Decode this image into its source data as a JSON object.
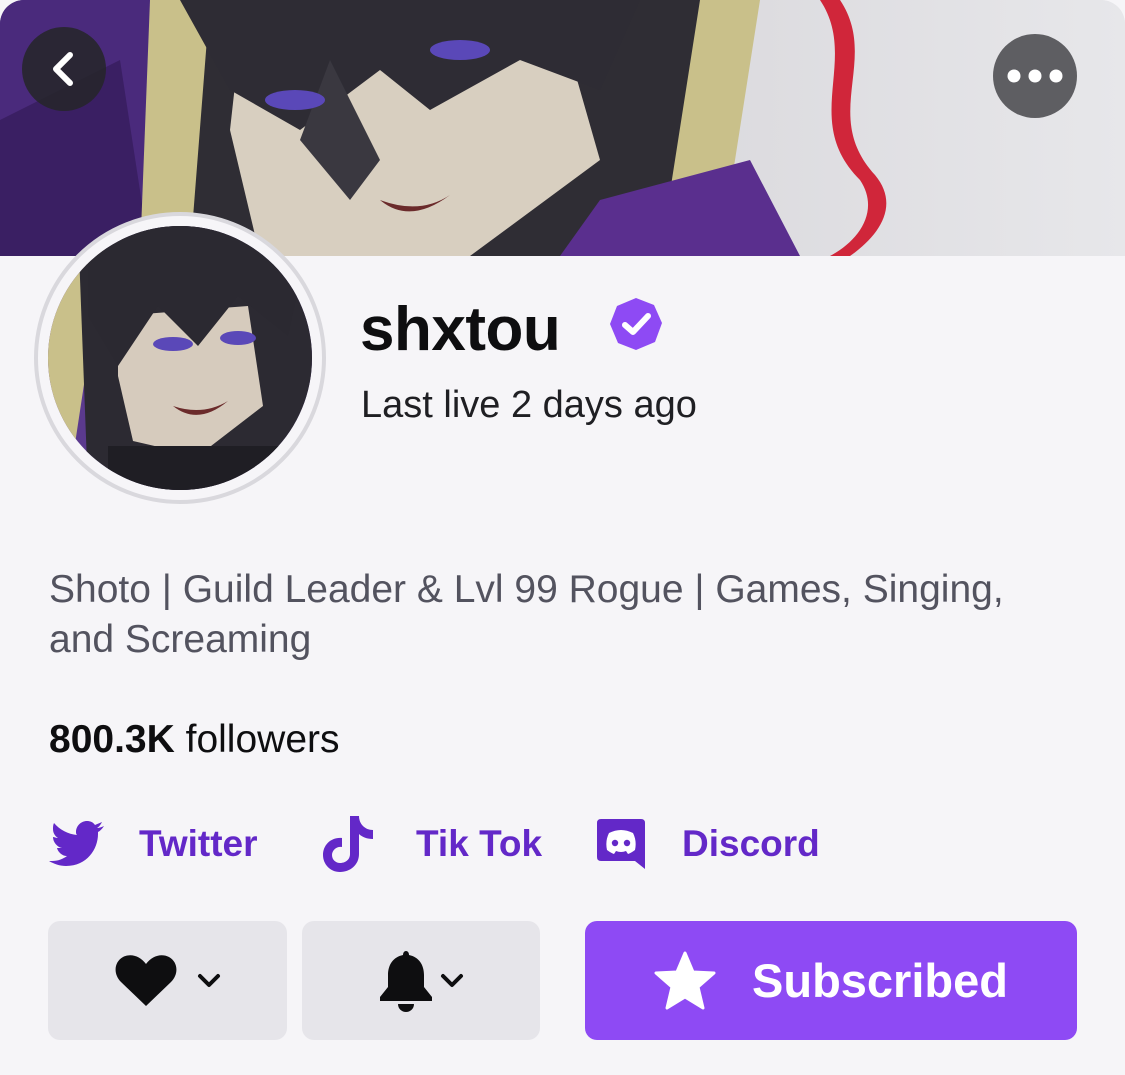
{
  "header": {
    "back_icon": "chevron-left-icon",
    "more_icon": "more-horizontal-icon"
  },
  "channel": {
    "name": "shxtou",
    "verified_icon": "verified-badge-icon",
    "last_live": "Last live 2 days ago",
    "bio": "Shoto | Guild Leader & Lvl 99 Rogue | Games, Singing, and Screaming",
    "followers_count": "800.3K",
    "followers_label": "followers"
  },
  "social_links": [
    {
      "label": "Twitter",
      "icon": "twitter-icon"
    },
    {
      "label": "Tik Tok",
      "icon": "tiktok-icon"
    },
    {
      "label": "Discord",
      "icon": "discord-icon"
    }
  ],
  "actions": {
    "follow_icon": "heart-icon",
    "notify_icon": "bell-icon",
    "subscribed_label": "Subscribed",
    "subscribed_icon": "star-icon"
  },
  "colors": {
    "accent": "#8e4af4",
    "link": "#6328c8",
    "background": "#f6f5f8"
  }
}
